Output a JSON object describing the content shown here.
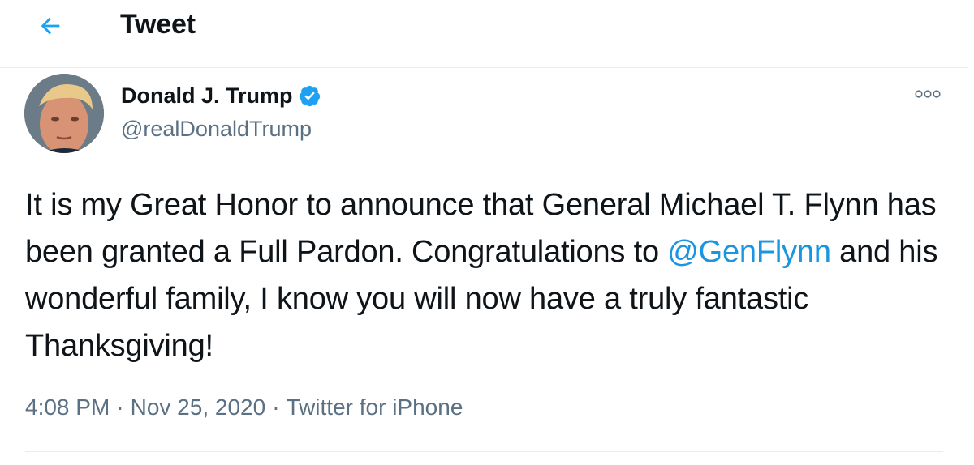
{
  "header": {
    "title": "Tweet",
    "back_icon": "arrow-left-icon"
  },
  "author": {
    "name": "Donald J. Trump",
    "handle": "@realDonaldTrump",
    "verified": true,
    "verified_icon": "verified-badge-icon",
    "avatar": "profile-photo"
  },
  "more_icon": "more-options-icon",
  "tweet": {
    "segments": [
      {
        "type": "text",
        "text": "It is my Great Honor to announce that General Michael T. Flynn has been granted a Full Pardon. Congratulations to "
      },
      {
        "type": "mention",
        "text": "@GenFlynn"
      },
      {
        "type": "text",
        "text": " and his wonderful family, I know you will now have a truly fantastic Thanksgiving!"
      }
    ]
  },
  "meta": {
    "time": "4:08 PM",
    "separator": "·",
    "date": "Nov 25, 2020",
    "source": "Twitter for iPhone"
  },
  "colors": {
    "accent": "#1b95e0",
    "text": "#0f1419",
    "muted": "#5b7083",
    "divider": "#e6ecf0",
    "verified": "#1da1f2"
  }
}
